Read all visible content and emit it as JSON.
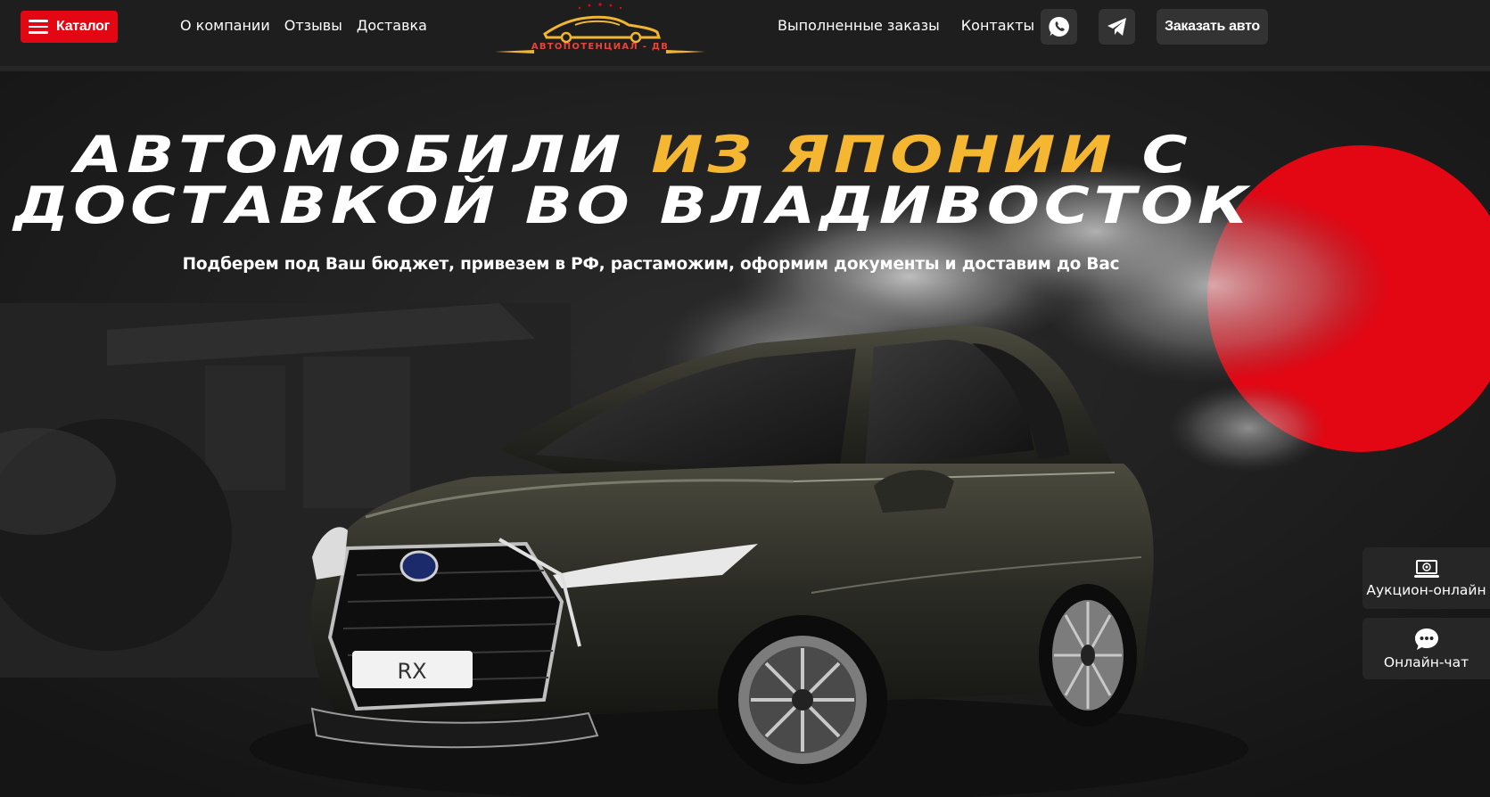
{
  "header": {
    "catalog_label": "Каталог",
    "nav_left": [
      "О компании",
      "Отзывы",
      "Доставка"
    ],
    "logo_text": "АВТОПОТЕНЦИАЛ - ДВ",
    "nav_right": [
      "Выполненные заказы",
      "Контакты"
    ],
    "order_label": "Заказать авто"
  },
  "hero": {
    "title_part1": "Автомобили",
    "title_accent": "из Японии",
    "title_part2": "с доставкой во Владивосток",
    "subtitle": "Подберем под Ваш бюджет, привезем в РФ, растаможим, оформим документы и доставим до Вас",
    "plate_text": "RX"
  },
  "widgets": {
    "auction_label": "Аукцион-онлайн",
    "chat_label": "Онлайн-чат"
  },
  "icons": {
    "catalog": "menu-icon",
    "whatsapp": "whatsapp-icon",
    "telegram": "telegram-icon",
    "auction": "monitor-icon",
    "chat": "chat-bubble-icon"
  },
  "colors": {
    "accent_red": "#e30613",
    "accent_yellow": "#f5b731",
    "background": "#1c1c1c",
    "button_bg": "#333333"
  }
}
